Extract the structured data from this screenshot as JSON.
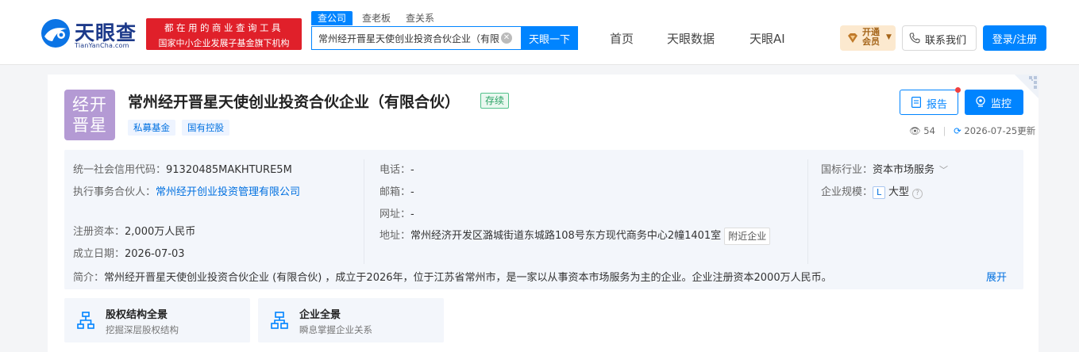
{
  "header": {
    "logo_text": "天眼查",
    "logo_domain": "TianYanCha.com",
    "banner_line1": "都在用的商业查询工具",
    "banner_line2": "国家中小企业发展子基金旗下机构",
    "search_tabs": [
      {
        "label": "查公司",
        "active": true
      },
      {
        "label": "查老板",
        "active": false
      },
      {
        "label": "查关系",
        "active": false
      }
    ],
    "search_value": "常州经开晋星天使创业投资合伙企业（有限",
    "search_button": "天眼一下",
    "nav": [
      "首页",
      "天眼数据",
      "天眼AI"
    ],
    "vip_line1": "开通",
    "vip_line2": "会员",
    "contact_label": "联系我们",
    "login_label": "登录/注册",
    "colors": {
      "brand": "#0084ff",
      "banner_red": "#e0202a",
      "vip_bg": "#fce9cf"
    }
  },
  "company": {
    "logo_line1": "经开",
    "logo_line2": "晋星",
    "name": "常州经开晋星天使创业投资合伙企业（有限合伙）",
    "status": "存续",
    "tags": [
      "私募基金",
      "国有控股"
    ],
    "report_label": "报告",
    "monitor_label": "监控",
    "views": "54",
    "updated": "2026-07-25更新",
    "logo_color": "#b49ad4"
  },
  "info": {
    "credit_code_label": "统一社会信用代码：",
    "credit_code": "91320485MAKHTURE5M",
    "partner_label": "执行事务合伙人：",
    "partner": "常州经开创业投资管理有限公司",
    "capital_label": "注册资本：",
    "capital": "2,000万人民币",
    "founded_label": "成立日期：",
    "founded": "2026-07-03",
    "phone_label": "电话：",
    "phone": "-",
    "email_label": "邮箱：",
    "email": "-",
    "website_label": "网址：",
    "website": "-",
    "address_label": "地址：",
    "address": "常州经济开发区潞城街道东城路108号东方现代商务中心2幢1401室",
    "nearby_label": "附近企业",
    "industry_label": "国标行业：",
    "industry": "资本市场服务",
    "scale_label": "企业规模：",
    "scale_badge": "L",
    "scale": "大型",
    "summary_label": "简介：",
    "summary": "常州经开晋星天使创业投资合伙企业 (有限合伙) ，成立于2026年，位于江苏省常州市，是一家以从事资本市场服务为主的企业。企业注册资本2000万人民币。",
    "expand_label": "展开"
  },
  "features": [
    {
      "title": "股权结构全景",
      "subtitle": "挖掘深层股权结构",
      "icon": "equity-structure-icon"
    },
    {
      "title": "企业全景",
      "subtitle": "瞬息掌握企业关系",
      "icon": "enterprise-network-icon"
    }
  ]
}
